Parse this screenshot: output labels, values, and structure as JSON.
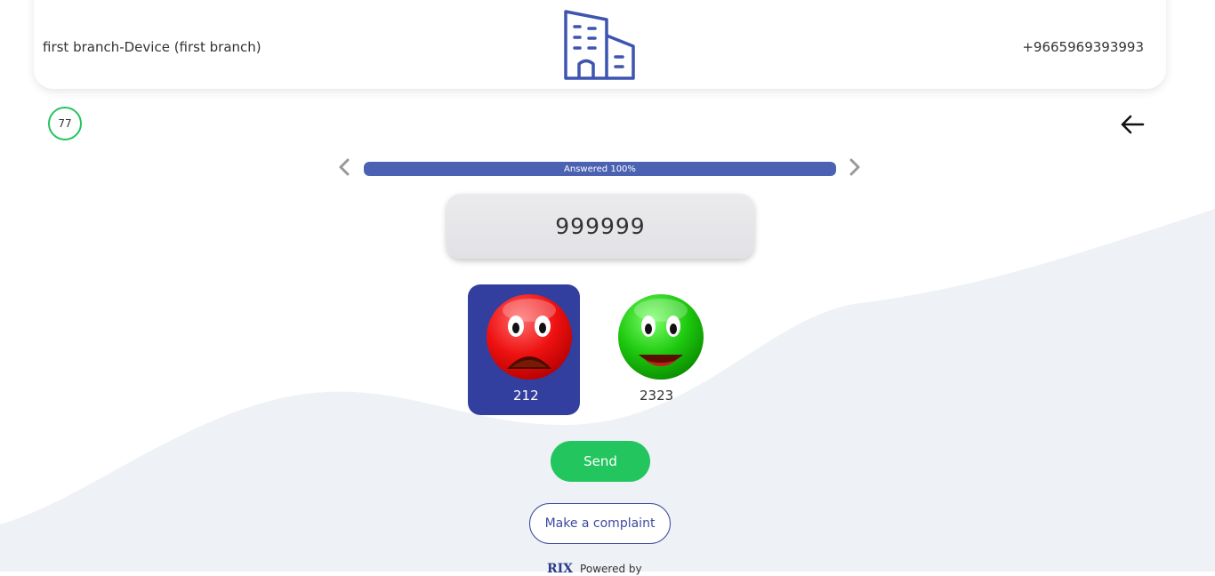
{
  "header": {
    "branch_name": "first branch-Device (first branch)",
    "phone": "+9665969393993",
    "center_icon": "building-icon"
  },
  "counter": {
    "value": "77"
  },
  "navigation": {
    "back_icon": "arrow-left-icon",
    "prev_icon": "chevron-left-icon",
    "next_icon": "chevron-right-icon"
  },
  "progress": {
    "label": "Answered 100%",
    "percent": 100
  },
  "question": {
    "text": "999999"
  },
  "options": [
    {
      "icon": "sad-face-icon",
      "label": "212",
      "selected": true
    },
    {
      "icon": "happy-face-icon",
      "label": "2323",
      "selected": false
    }
  ],
  "actions": {
    "send_label": "Send",
    "complaint_label": "Make a complaint"
  },
  "footer": {
    "logo_text": "RIX",
    "text": "Powered by"
  },
  "colors": {
    "primary": "#323f9e",
    "accent_green": "#22c55e",
    "progress_fill": "#4b62b3",
    "background_wave": "#eef1f5"
  }
}
